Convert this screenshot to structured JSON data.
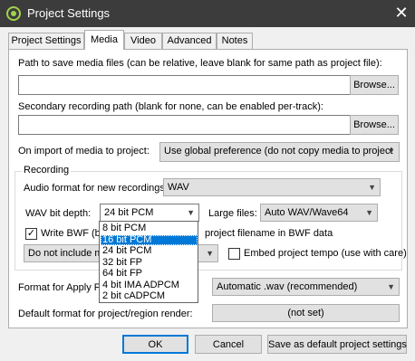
{
  "window": {
    "title": "Project Settings",
    "close_glyph": "✕",
    "icon": "reaper-app-icon"
  },
  "tabs": [
    {
      "label": "Project Settings",
      "active": false
    },
    {
      "label": "Media",
      "active": true
    },
    {
      "label": "Video",
      "active": false
    },
    {
      "label": "Advanced",
      "active": false
    },
    {
      "label": "Notes",
      "active": false
    }
  ],
  "media": {
    "path_label": "Path to save media files (can be relative, leave blank for same path as project file):",
    "path_value": "",
    "path_browse": "Browse...",
    "secondary_label": "Secondary recording path (blank for none, can be enabled per-track):",
    "secondary_value": "",
    "secondary_browse": "Browse...",
    "import_label": "On import of media to project:",
    "import_value": "Use global preference (do not copy media to project"
  },
  "recording": {
    "group_label": "Recording",
    "audio_format_label": "Audio format for new recordings:",
    "audio_format_value": "WAV",
    "wav_bit_depth_label": "WAV bit depth:",
    "wav_bit_depth_value": "24 bit PCM",
    "large_files_label": "Large files:",
    "large_files_value": "Auto WAV/Wave64",
    "write_bwf_label": "Write BWF (b",
    "write_bwf_checked": true,
    "project_filename_label": "project filename in BWF data",
    "include_value": "Do not include m",
    "embed_tempo_label": "Embed project tempo (use with care)",
    "embed_tempo_checked": false
  },
  "bit_depth_options": [
    {
      "label": "8 bit PCM",
      "selected": false
    },
    {
      "label": "16 bit PCM",
      "selected": true
    },
    {
      "label": "24 bit PCM",
      "selected": false
    },
    {
      "label": "32 bit FP",
      "selected": false
    },
    {
      "label": "64 bit FP",
      "selected": false
    },
    {
      "label": "4 bit IMA ADPCM",
      "selected": false
    },
    {
      "label": "2 bit cADPCM",
      "selected": false
    }
  ],
  "formats": {
    "apply_fx_label": "Format for Apply FX",
    "apply_fx_value": "Automatic .wav (recommended)",
    "default_render_label": "Default format for project/region render:",
    "default_render_value": "(not set)"
  },
  "footer": {
    "ok": "OK",
    "cancel": "Cancel",
    "save_default": "Save as default project settings"
  },
  "colors": {
    "titlebar": "#3c3c3c",
    "accent": "#0078d7"
  }
}
